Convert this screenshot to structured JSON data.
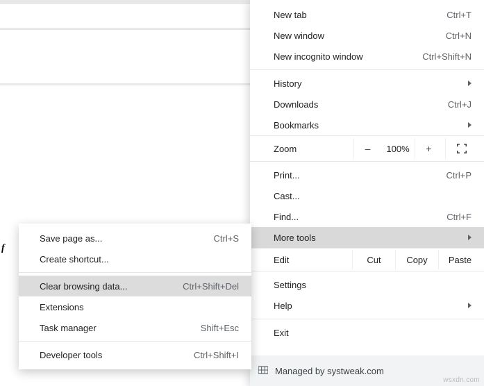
{
  "mainMenu": {
    "new_tab": "New tab",
    "new_tab_sc": "Ctrl+T",
    "new_window": "New window",
    "new_window_sc": "Ctrl+N",
    "new_incognito": "New incognito window",
    "new_incognito_sc": "Ctrl+Shift+N",
    "history": "History",
    "downloads": "Downloads",
    "downloads_sc": "Ctrl+J",
    "bookmarks": "Bookmarks",
    "zoom_label": "Zoom",
    "zoom_minus": "–",
    "zoom_pct": "100%",
    "zoom_plus": "+",
    "print": "Print...",
    "print_sc": "Ctrl+P",
    "cast": "Cast...",
    "find": "Find...",
    "find_sc": "Ctrl+F",
    "more_tools": "More tools",
    "edit_label": "Edit",
    "cut": "Cut",
    "copy": "Copy",
    "paste": "Paste",
    "settings": "Settings",
    "help": "Help",
    "exit": "Exit",
    "managed": "Managed by systweak.com"
  },
  "subMenu": {
    "save_page": "Save page as...",
    "save_page_sc": "Ctrl+S",
    "create_shortcut": "Create shortcut...",
    "clear_browsing": "Clear browsing data...",
    "clear_browsing_sc": "Ctrl+Shift+Del",
    "extensions": "Extensions",
    "task_manager": "Task manager",
    "task_manager_sc": "Shift+Esc",
    "dev_tools": "Developer tools",
    "dev_tools_sc": "Ctrl+Shift+I"
  },
  "misc": {
    "vowel": "f",
    "watermark": "wsxdn.com"
  }
}
